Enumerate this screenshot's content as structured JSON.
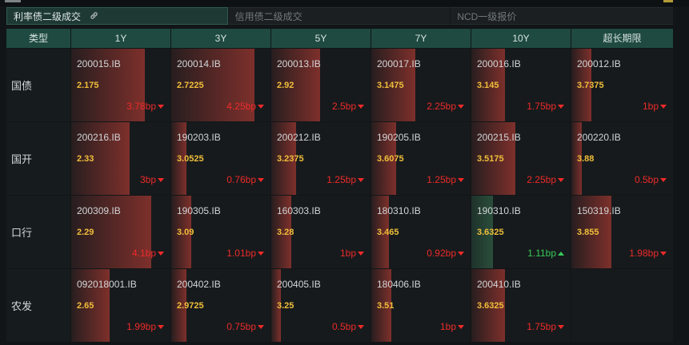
{
  "tabs": [
    {
      "label": "利率债二级成交",
      "active": true
    },
    {
      "label": "信用债二级成交",
      "active": false
    },
    {
      "label": "NCD一级报价",
      "active": false
    }
  ],
  "columns": [
    "类型",
    "1Y",
    "3Y",
    "5Y",
    "7Y",
    "10Y",
    "超长期限"
  ],
  "rows": [
    {
      "label": "国债",
      "cells": [
        {
          "code": "200015.IB",
          "yield": "2.175",
          "change": "3.78bp",
          "dir": "down",
          "level": 0.74
        },
        {
          "code": "200014.IB",
          "yield": "2.7225",
          "change": "4.25bp",
          "dir": "down",
          "level": 0.84
        },
        {
          "code": "200013.IB",
          "yield": "2.92",
          "change": "2.5bp",
          "dir": "down",
          "level": 0.49
        },
        {
          "code": "200017.IB",
          "yield": "3.1475",
          "change": "2.25bp",
          "dir": "down",
          "level": 0.44
        },
        {
          "code": "200016.IB",
          "yield": "3.145",
          "change": "1.75bp",
          "dir": "down",
          "level": 0.34
        },
        {
          "code": "200012.IB",
          "yield": "3.7375",
          "change": "1bp",
          "dir": "down",
          "level": 0.2
        }
      ]
    },
    {
      "label": "国开",
      "cells": [
        {
          "code": "200216.IB",
          "yield": "2.33",
          "change": "3bp",
          "dir": "down",
          "level": 0.59
        },
        {
          "code": "190203.IB",
          "yield": "3.0525",
          "change": "0.76bp",
          "dir": "down",
          "level": 0.15
        },
        {
          "code": "200212.IB",
          "yield": "3.2375",
          "change": "1.25bp",
          "dir": "down",
          "level": 0.25
        },
        {
          "code": "190205.IB",
          "yield": "3.6075",
          "change": "1.25bp",
          "dir": "down",
          "level": 0.25
        },
        {
          "code": "200215.IB",
          "yield": "3.5175",
          "change": "2.25bp",
          "dir": "down",
          "level": 0.44
        },
        {
          "code": "200220.IB",
          "yield": "3.88",
          "change": "0.5bp",
          "dir": "down",
          "level": 0.1
        }
      ]
    },
    {
      "label": "口行",
      "cells": [
        {
          "code": "200309.IB",
          "yield": "2.29",
          "change": "4.1bp",
          "dir": "down",
          "level": 0.81
        },
        {
          "code": "190305.IB",
          "yield": "3.09",
          "change": "1.01bp",
          "dir": "down",
          "level": 0.2
        },
        {
          "code": "160303.IB",
          "yield": "3.28",
          "change": "1bp",
          "dir": "down",
          "level": 0.2
        },
        {
          "code": "180310.IB",
          "yield": "3.465",
          "change": "0.92bp",
          "dir": "down",
          "level": 0.18
        },
        {
          "code": "190310.IB",
          "yield": "3.6325",
          "change": "1.11bp",
          "dir": "up",
          "level": 0.22
        },
        {
          "code": "150319.IB",
          "yield": "3.855",
          "change": "1.98bp",
          "dir": "down",
          "level": 0.39
        }
      ]
    },
    {
      "label": "农发",
      "cells": [
        {
          "code": "092018001.IB",
          "yield": "2.65",
          "change": "1.99bp",
          "dir": "down",
          "level": 0.39
        },
        {
          "code": "200402.IB",
          "yield": "2.9725",
          "change": "0.75bp",
          "dir": "down",
          "level": 0.15
        },
        {
          "code": "200405.IB",
          "yield": "3.25",
          "change": "0.5bp",
          "dir": "down",
          "level": 0.1
        },
        {
          "code": "180406.IB",
          "yield": "3.51",
          "change": "1bp",
          "dir": "down",
          "level": 0.2
        },
        {
          "code": "200410.IB",
          "yield": "3.6325",
          "change": "1.75bp",
          "dir": "down",
          "level": 0.34
        },
        null
      ]
    }
  ],
  "colors": {
    "down": "#ee2a2a",
    "up": "#37c95a",
    "yield": "#f0bf3a",
    "header": "#1f4a41"
  },
  "icons": {
    "tab_link": "link-icon",
    "down": "down-triangle-icon",
    "up": "up-triangle-icon"
  }
}
